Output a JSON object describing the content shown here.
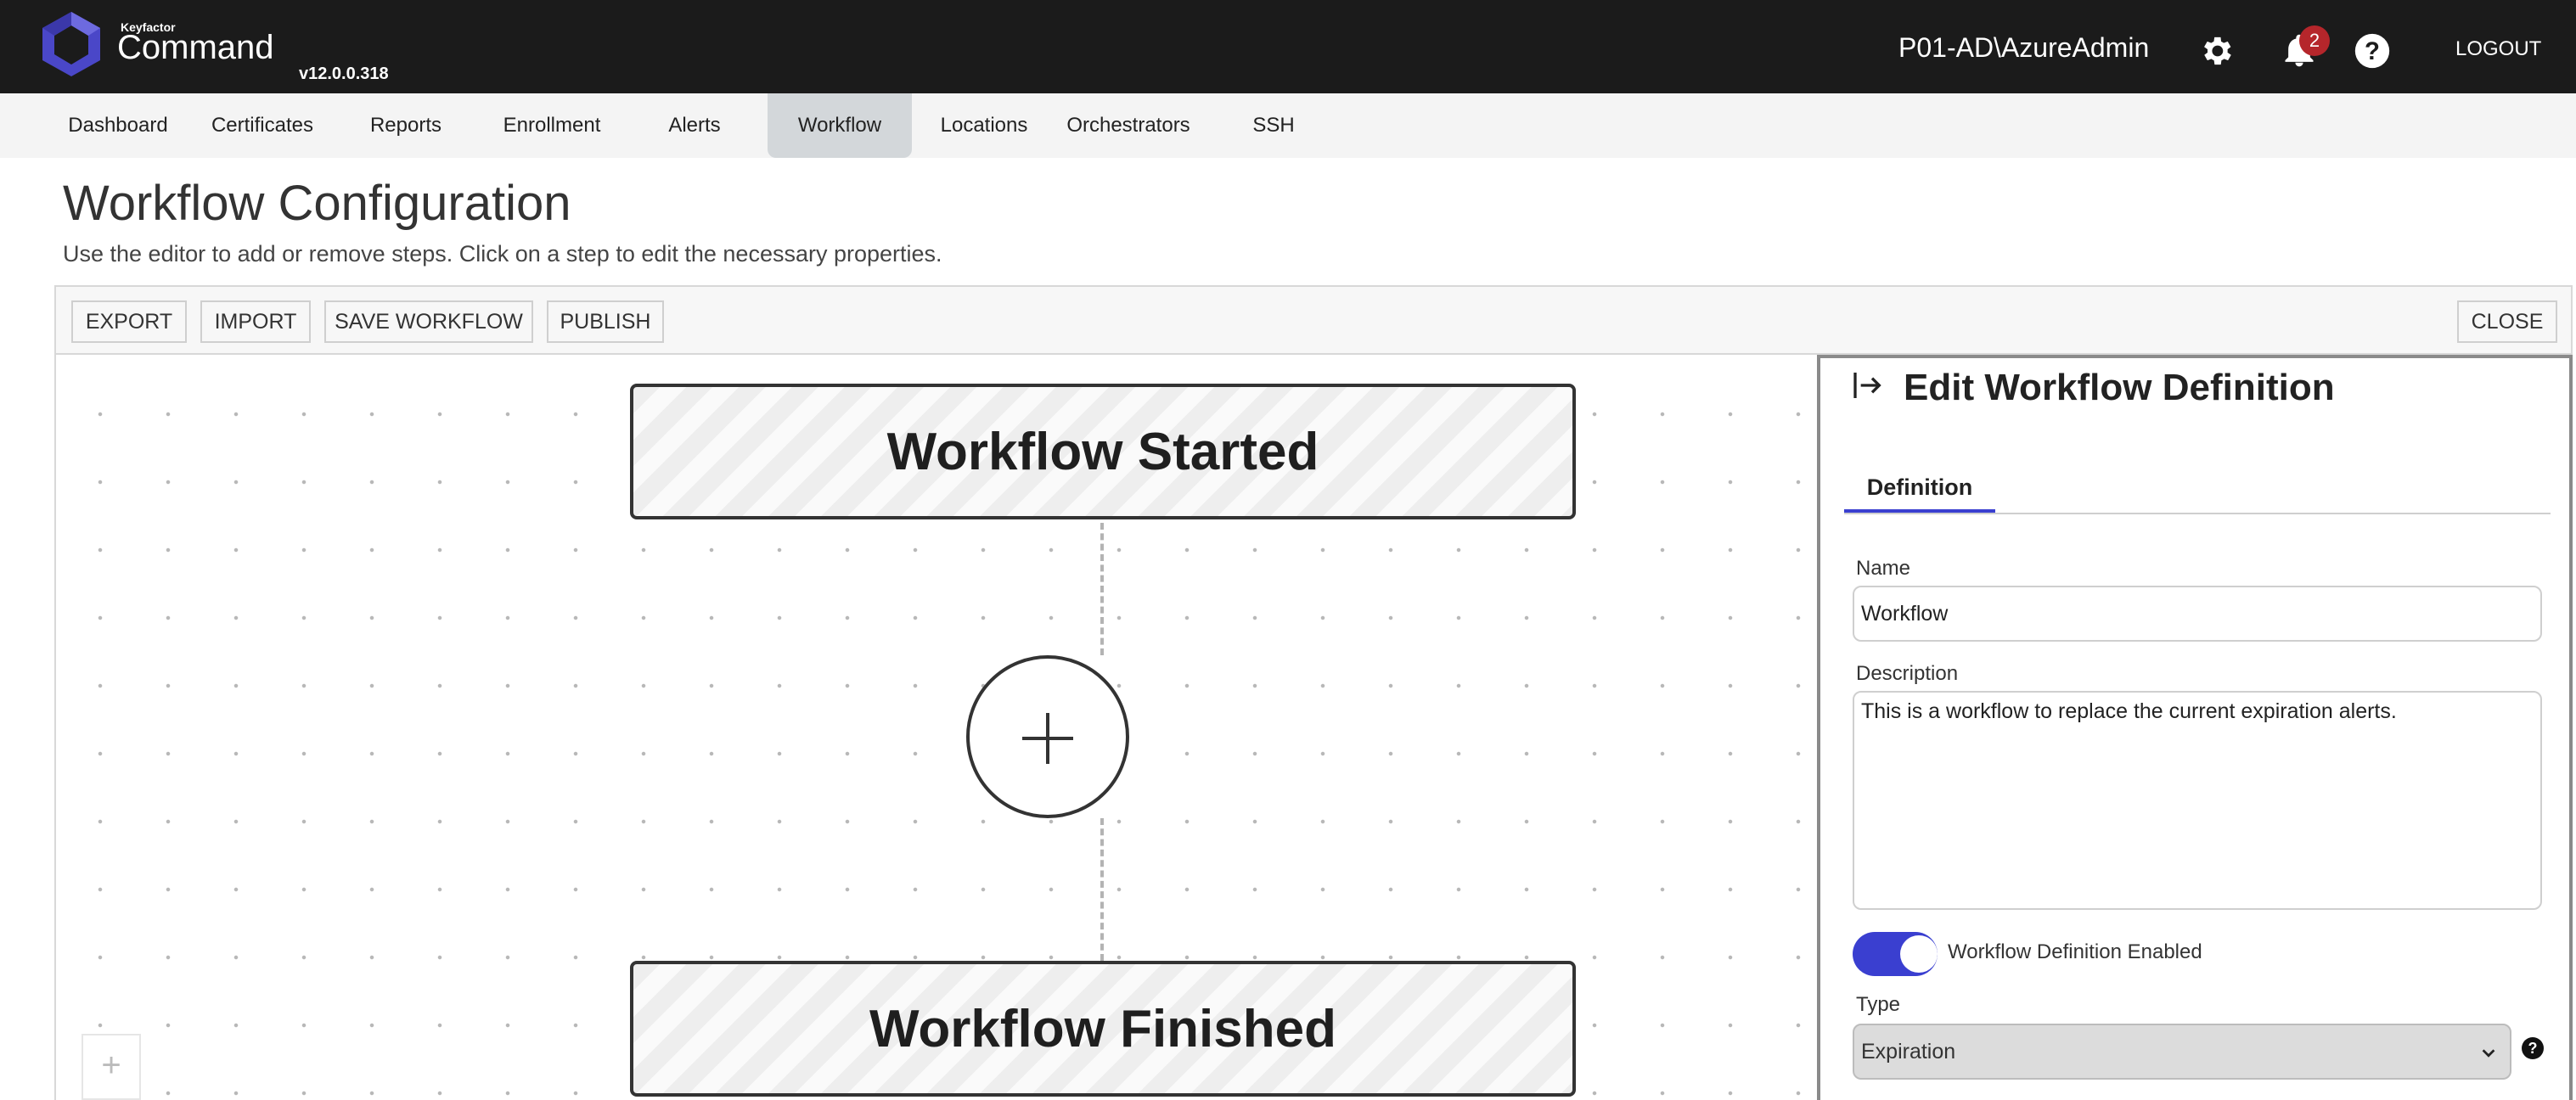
{
  "header": {
    "brand_small": "Keyfactor",
    "brand_name": "Command",
    "version": "v12.0.0.318",
    "username": "P01-AD\\AzureAdmin",
    "notification_count": "2",
    "logout_label": "LOGOUT",
    "icons": [
      "keyfactor-logo-icon",
      "gear-icon",
      "bell-icon",
      "help-icon"
    ]
  },
  "nav": {
    "items": [
      "Dashboard",
      "Certificates",
      "Reports",
      "Enrollment",
      "Alerts",
      "Workflow",
      "Locations",
      "Orchestrators",
      "SSH"
    ],
    "active": "Workflow"
  },
  "page": {
    "title": "Workflow Configuration",
    "subtitle": "Use the editor to add or remove steps. Click on a step to edit the necessary properties."
  },
  "toolbar": {
    "export_label": "EXPORT",
    "import_label": "IMPORT",
    "save_label": "SAVE WORKFLOW",
    "publish_label": "PUBLISH",
    "close_label": "CLOSE"
  },
  "canvas": {
    "start_step": "Workflow Started",
    "end_step": "Workflow Finished",
    "add_step_symbol": "+",
    "zoom_symbol": "+"
  },
  "panel": {
    "title": "Edit Workflow Definition",
    "tab": "Definition",
    "name_label": "Name",
    "name_value": "Workflow",
    "description_label": "Description",
    "description_value": "This is a workflow to replace the current expiration alerts.",
    "enabled_label": "Workflow Definition Enabled",
    "enabled": true,
    "type_label": "Type",
    "type_value": "Expiration",
    "help_symbol": "?"
  },
  "colors": {
    "topbar": "#1b1b1b",
    "accent": "#3a3fd0",
    "badge": "#b5262b",
    "logo": "#4a47c8"
  }
}
